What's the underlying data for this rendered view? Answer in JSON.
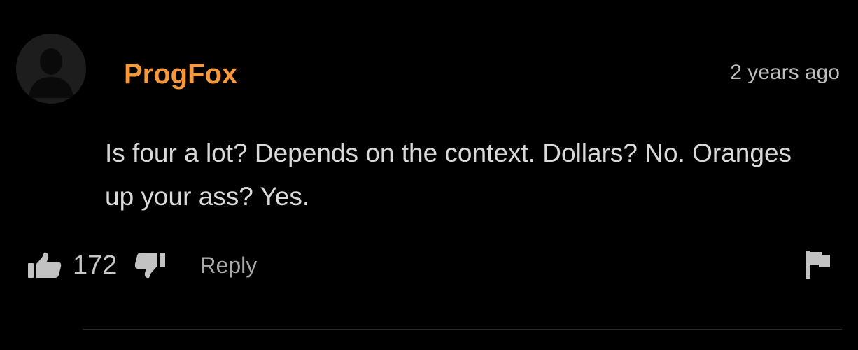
{
  "comment": {
    "username": "ProgFox",
    "timestamp": "2 years ago",
    "text": "Is four a lot? Depends on the context. Dollars? No. Oranges up your ass? Yes.",
    "votes": "172",
    "reply_label": "Reply"
  },
  "icons": {
    "avatar": "default-user-avatar",
    "upvote": "thumbs-up-icon",
    "downvote": "thumbs-down-icon",
    "flag": "flag-icon"
  },
  "colors": {
    "background": "#000000",
    "username": "#f7983a",
    "text": "#d9d9d9",
    "muted": "#a9a9a9"
  }
}
